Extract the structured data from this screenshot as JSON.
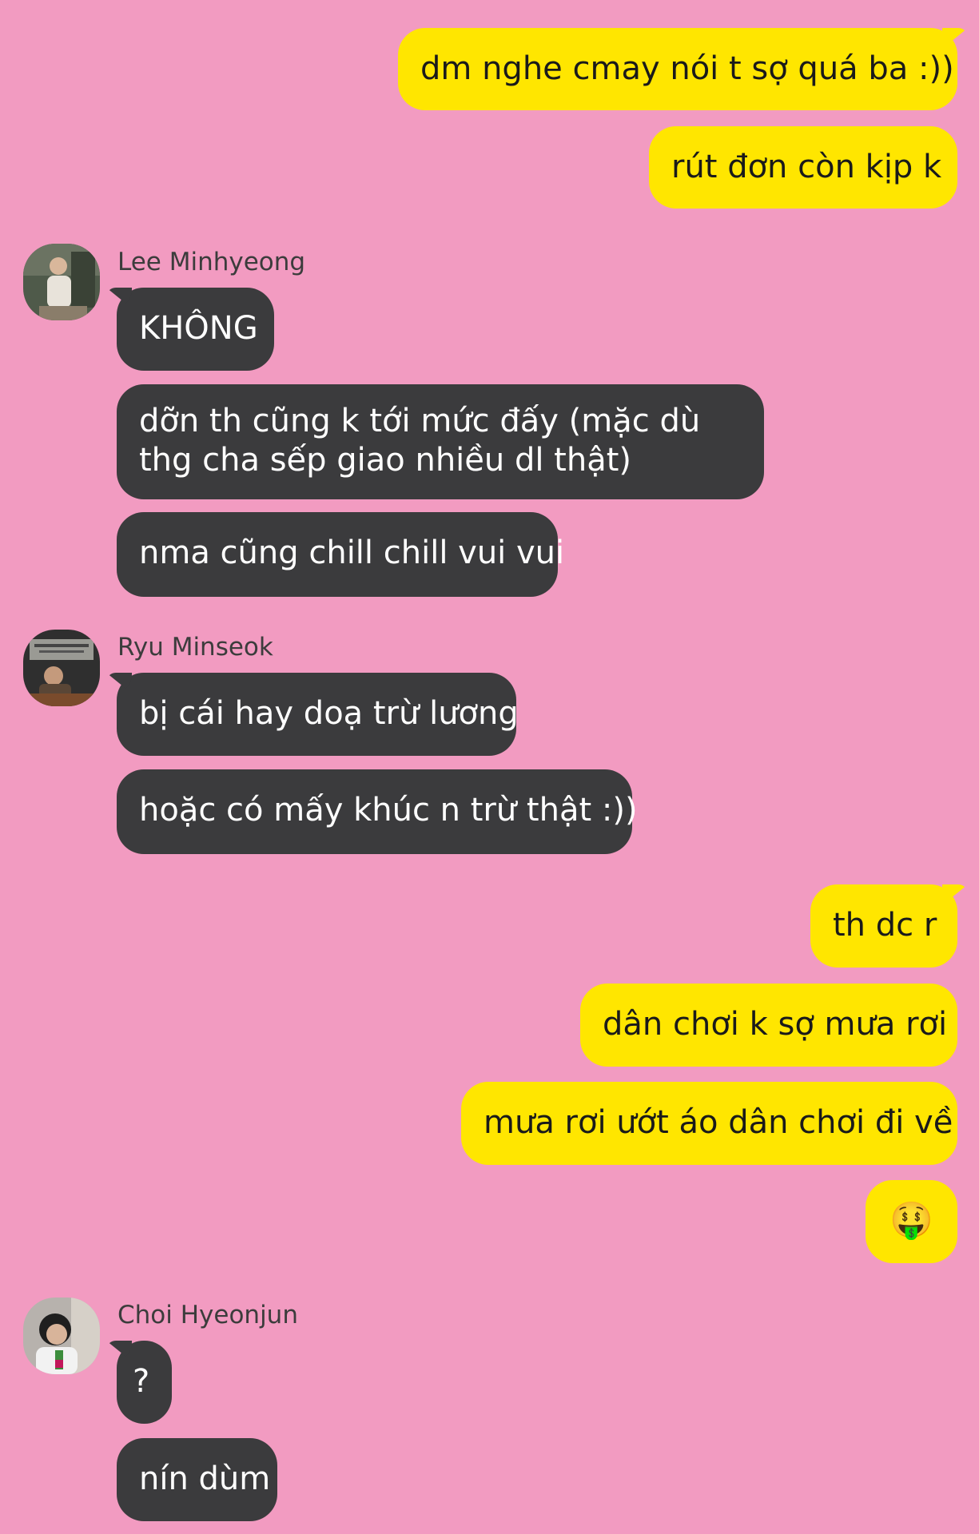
{
  "messages": [
    {
      "side": "me",
      "text": "dm nghe cmay nói t sợ quá ba :))"
    },
    {
      "side": "me",
      "text": "rút đơn còn kịp k"
    },
    {
      "side": "them",
      "sender": "Lee Minhyeong",
      "text": "KHÔNG"
    },
    {
      "side": "them",
      "text": "dỡn th cũng k tới mức đấy (mặc dù thg cha sếp giao nhiều dl thật)"
    },
    {
      "side": "them",
      "text": "nma cũng chill chill vui vui"
    },
    {
      "side": "them",
      "sender": "Ryu Minseok",
      "text": "bị cái hay doạ trừ lương"
    },
    {
      "side": "them",
      "text": "hoặc có mấy khúc n trừ thật :))"
    },
    {
      "side": "me",
      "text": "th dc r"
    },
    {
      "side": "me",
      "text": "dân chơi k sợ mưa rơi"
    },
    {
      "side": "me",
      "text": "mưa rơi ướt áo dân chơi đi về"
    },
    {
      "side": "me",
      "text": "🤑",
      "icon": "money-mouth-face-emoji"
    },
    {
      "side": "them",
      "sender": "Choi Hyeonjun",
      "text": "?"
    },
    {
      "side": "them",
      "text": "nín dùm"
    }
  ],
  "colors": {
    "background": "#f29bc1",
    "my_bubble": "#ffe600",
    "their_bubble": "#3b3b3d",
    "their_text": "#ffffff"
  }
}
